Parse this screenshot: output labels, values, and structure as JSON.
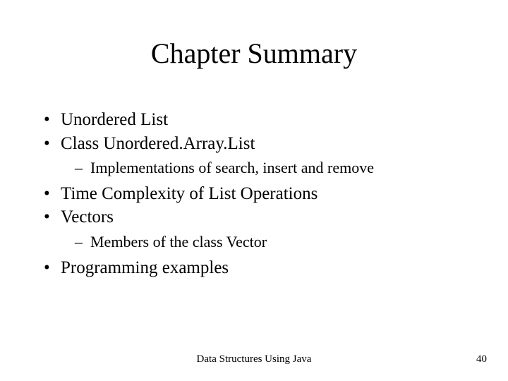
{
  "title": "Chapter Summary",
  "bullets": {
    "b1": "Unordered List",
    "b2": "Class Unordered.Array.List",
    "b2_sub1": "Implementations of search, insert and remove",
    "b3": "Time Complexity of List Operations",
    "b4": "Vectors",
    "b4_sub1": "Members of the class Vector",
    "b5": "Programming examples"
  },
  "footer": {
    "center": "Data Structures Using Java",
    "page": "40"
  }
}
